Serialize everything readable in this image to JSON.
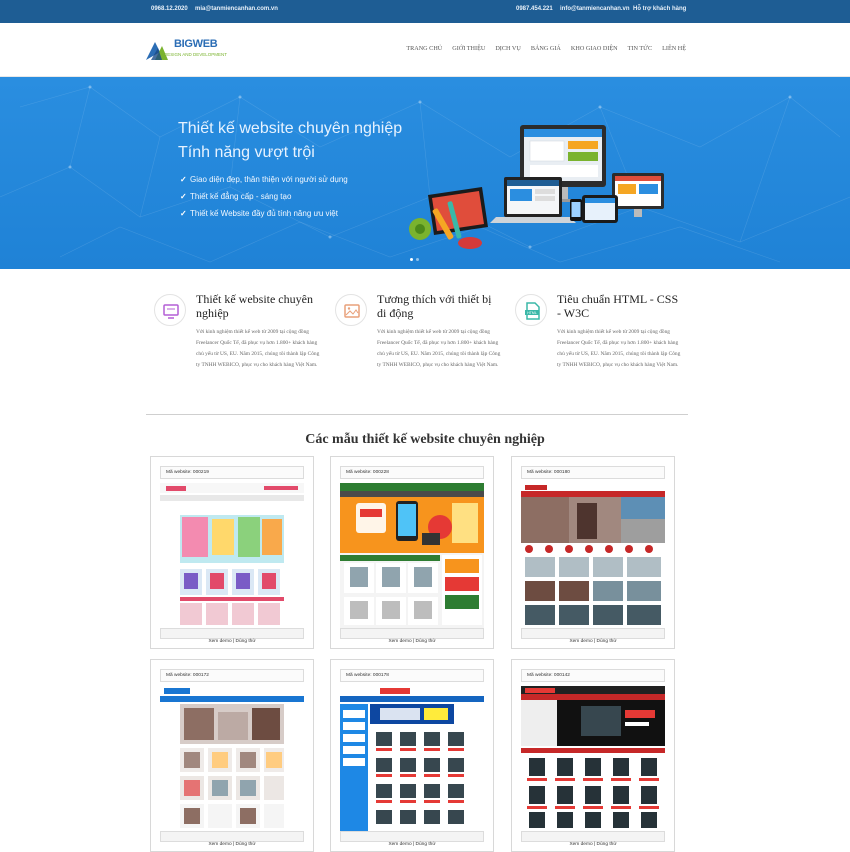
{
  "topbar": {
    "phone_left": "0968.12.2020",
    "email_left": "mia@tanmiencanhan.com.vn",
    "phone_right": "0987.454.221",
    "email_right": "info@tanmiencanhan.vn",
    "support": "Hỗ trợ khách hàng"
  },
  "header": {
    "logo_text": "BIGWEB",
    "logo_sub": "DESIGN AND DEVELOPMENT",
    "nav": [
      "TRANG CHỦ",
      "GIỚI THIỆU",
      "DỊCH VỤ",
      "BẢNG GIÁ",
      "KHO GIAO DIỆN",
      "TIN TỨC",
      "LIÊN HỆ"
    ]
  },
  "hero": {
    "line1": "Thiết kế website chuyên nghiệp",
    "line2": "Tính năng vượt trội",
    "bullets": [
      "Giao diện đẹp, thân thiện với người sử dụng",
      "Thiết kế đẳng cấp - sáng tạo",
      "Thiết kế Website đầy đủ tính năng ưu việt"
    ]
  },
  "features": [
    {
      "title": "Thiết kế website chuyên nghiệp",
      "desc": "Với kinh nghiệm thiết kế web từ 2009 tại cộng đồng Freelancer Quốc Tế, đã phục vụ hơn 1.800+ khách hàng chủ yếu từ US, EU. Năm 2015, chúng tôi thành lập Công ty TNHH WEBICO, phục vụ cho khách hàng Việt Nam.",
      "icon": "monitor-icon",
      "color": "#b45fd6"
    },
    {
      "title": "Tương thích với thiết bị di động",
      "desc": "Với kinh nghiệm thiết kế web từ 2009 tại cộng đồng Freelancer Quốc Tế, đã phục vụ hơn 1.800+ khách hàng chủ yếu từ US, EU. Năm 2015, chúng tôi thành lập Công ty TNHH WEBICO, phục vụ cho khách hàng Việt Nam.",
      "icon": "image-icon",
      "color": "#e8a07a"
    },
    {
      "title": "Tiêu chuẩn HTML - CSS - W3C",
      "desc": "Với kinh nghiệm thiết kế web từ 2009 tại cộng đồng Freelancer Quốc Tế, đã phục vụ hơn 1.800+ khách hàng chủ yếu từ US, EU. Năm 2015, chúng tôi thành lập Công ty TNHH WEBICO, phục vụ cho khách hàng Việt Nam.",
      "icon": "html-file-icon",
      "color": "#3bb8a8"
    }
  ],
  "section_title": "Các mẫu thiết kế website chuyên nghiệp",
  "templates": [
    {
      "code": "Mã website: 000219",
      "footer": "Xem demo | Dùng thử",
      "theme": "pink-kids"
    },
    {
      "code": "Mã website: 000228",
      "footer": "Xem demo | Dùng thử",
      "theme": "orange-phone"
    },
    {
      "code": "Mã website: 000180",
      "footer": "Xem demo | Dùng thử",
      "theme": "red-interior"
    },
    {
      "code": "Mã website: 000172",
      "footer": "Xem demo | Dùng thử",
      "theme": "blue-furniture"
    },
    {
      "code": "Mã website: 000178",
      "footer": "Xem demo | Dùng thử",
      "theme": "blue-computer"
    },
    {
      "code": "Mã website: 000142",
      "footer": "Xem demo | Dùng thử",
      "theme": "dark-computer"
    }
  ],
  "colors": {
    "topbar": "#1e5d94",
    "hero": "#2a8ee0",
    "logo": "#2b6db5"
  }
}
